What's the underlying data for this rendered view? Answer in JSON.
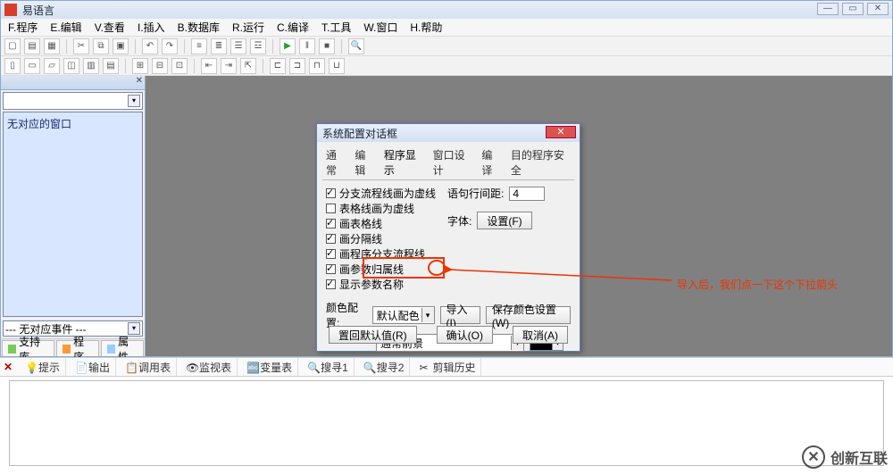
{
  "app": {
    "title": "易语言"
  },
  "menu": {
    "program": "F.程序",
    "edit": "E.编辑",
    "view": "V.查看",
    "insert": "I.插入",
    "db": "B.数据库",
    "run": "R.运行",
    "compile": "C.编译",
    "tools": "T.工具",
    "window": "W.窗口",
    "help": "H.帮助"
  },
  "sidebar": {
    "placeholder_text": "无对应的窗口",
    "foot_text": "--- 无对应事件 ---",
    "tabs": {
      "support": "支持库",
      "program": "程序",
      "property": "属性"
    }
  },
  "dialog": {
    "title": "系统配置对话框",
    "tabs": {
      "normal": "通常",
      "edit": "编辑",
      "display": "程序显示",
      "window": "窗口设计",
      "compile": "编译",
      "security": "目的程序安全"
    },
    "checks": {
      "c1": "分支流程线画为虚线",
      "c2": "表格线画为虚线",
      "c3": "画表格线",
      "c4": "画分隔线",
      "c5": "画程序分支流程线",
      "c6": "画参数归属线",
      "c7": "显示参数名称"
    },
    "spacing_label": "语句行间距:",
    "spacing_value": "4",
    "font_label": "字体:",
    "font_btn": "设置(F)",
    "color_scheme_label": "颜色配置:",
    "color_scheme_value": "默认配色",
    "import_btn": "导入(I)",
    "save_btn": "保存颜色设置(W)",
    "fg_value": "通常前景",
    "buttons": {
      "reset": "置回默认值(R)",
      "ok": "确认(O)",
      "cancel": "取消(A)"
    }
  },
  "bottom_tabs": {
    "hint": "提示",
    "output": "输出",
    "call": "调用表",
    "watch": "监视表",
    "var": "变量表",
    "find": "搜寻1",
    "find2": "搜寻2",
    "clip": "剪辑历史"
  },
  "annotation": {
    "text": "导入后，我们点一下这个下拉箭头"
  },
  "watermark": {
    "text": "创新互联"
  }
}
